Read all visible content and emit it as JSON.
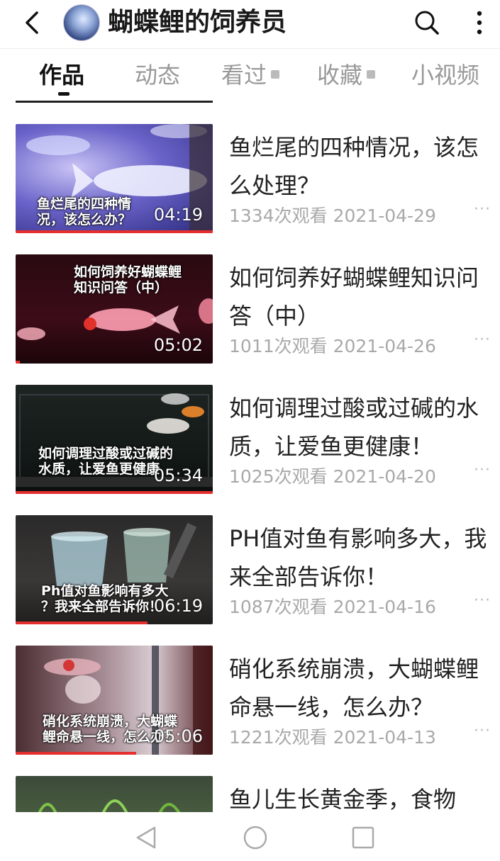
{
  "header": {
    "title": "蝴蝶鲤的饲养员"
  },
  "tabs": [
    {
      "label": "作品",
      "active": true,
      "locked": false
    },
    {
      "label": "动态",
      "active": false,
      "locked": false
    },
    {
      "label": "看过",
      "active": false,
      "locked": true
    },
    {
      "label": "收藏",
      "active": false,
      "locked": true
    },
    {
      "label": "小视频",
      "active": false,
      "locked": false
    }
  ],
  "videos": [
    {
      "title": "鱼烂尾的四种情况，该怎么处理？",
      "caption": "鱼烂尾的四种情\n况，该怎么办？",
      "duration": "04:19",
      "views": "1334次观看",
      "date": "2021-04-29",
      "watched_fraction": 1.0
    },
    {
      "title": "如何饲养好蝴蝶鲤知识问答（中）",
      "caption": "如何饲养好蝴蝶鲤\n知识问答（中）",
      "duration": "05:02",
      "views": "1011次观看",
      "date": "2021-04-26",
      "watched_fraction": 0.02
    },
    {
      "title": "如何调理过酸或过碱的水质，让爱鱼更健康！",
      "caption": "如何调理过酸或过碱的\n水质，让爱鱼更健康",
      "duration": "05:34",
      "views": "1025次观看",
      "date": "2021-04-20",
      "watched_fraction": 1.0
    },
    {
      "title": "PH值对鱼有影响多大，我来全部告诉你！",
      "caption": "Ph值对鱼影响有多大\n？我来全部告诉你！",
      "duration": "06:19",
      "views": "1087次观看",
      "date": "2021-04-16",
      "watched_fraction": 0.67
    },
    {
      "title": "硝化系统崩溃，大蝴蝶鲤命悬一线，怎么办？",
      "caption": "硝化系统崩溃，大蝴蝶\n鲤命悬一线，怎么办？",
      "duration": "05:06",
      "views": "1221次观看",
      "date": "2021-04-13",
      "watched_fraction": 0.61
    },
    {
      "title": "鱼儿生长黄金季，食物"
    }
  ],
  "more_label": "···",
  "colors": {
    "accent": "#e52e2e",
    "meta_text": "#a9a9a9",
    "tab_inactive": "#999999"
  }
}
